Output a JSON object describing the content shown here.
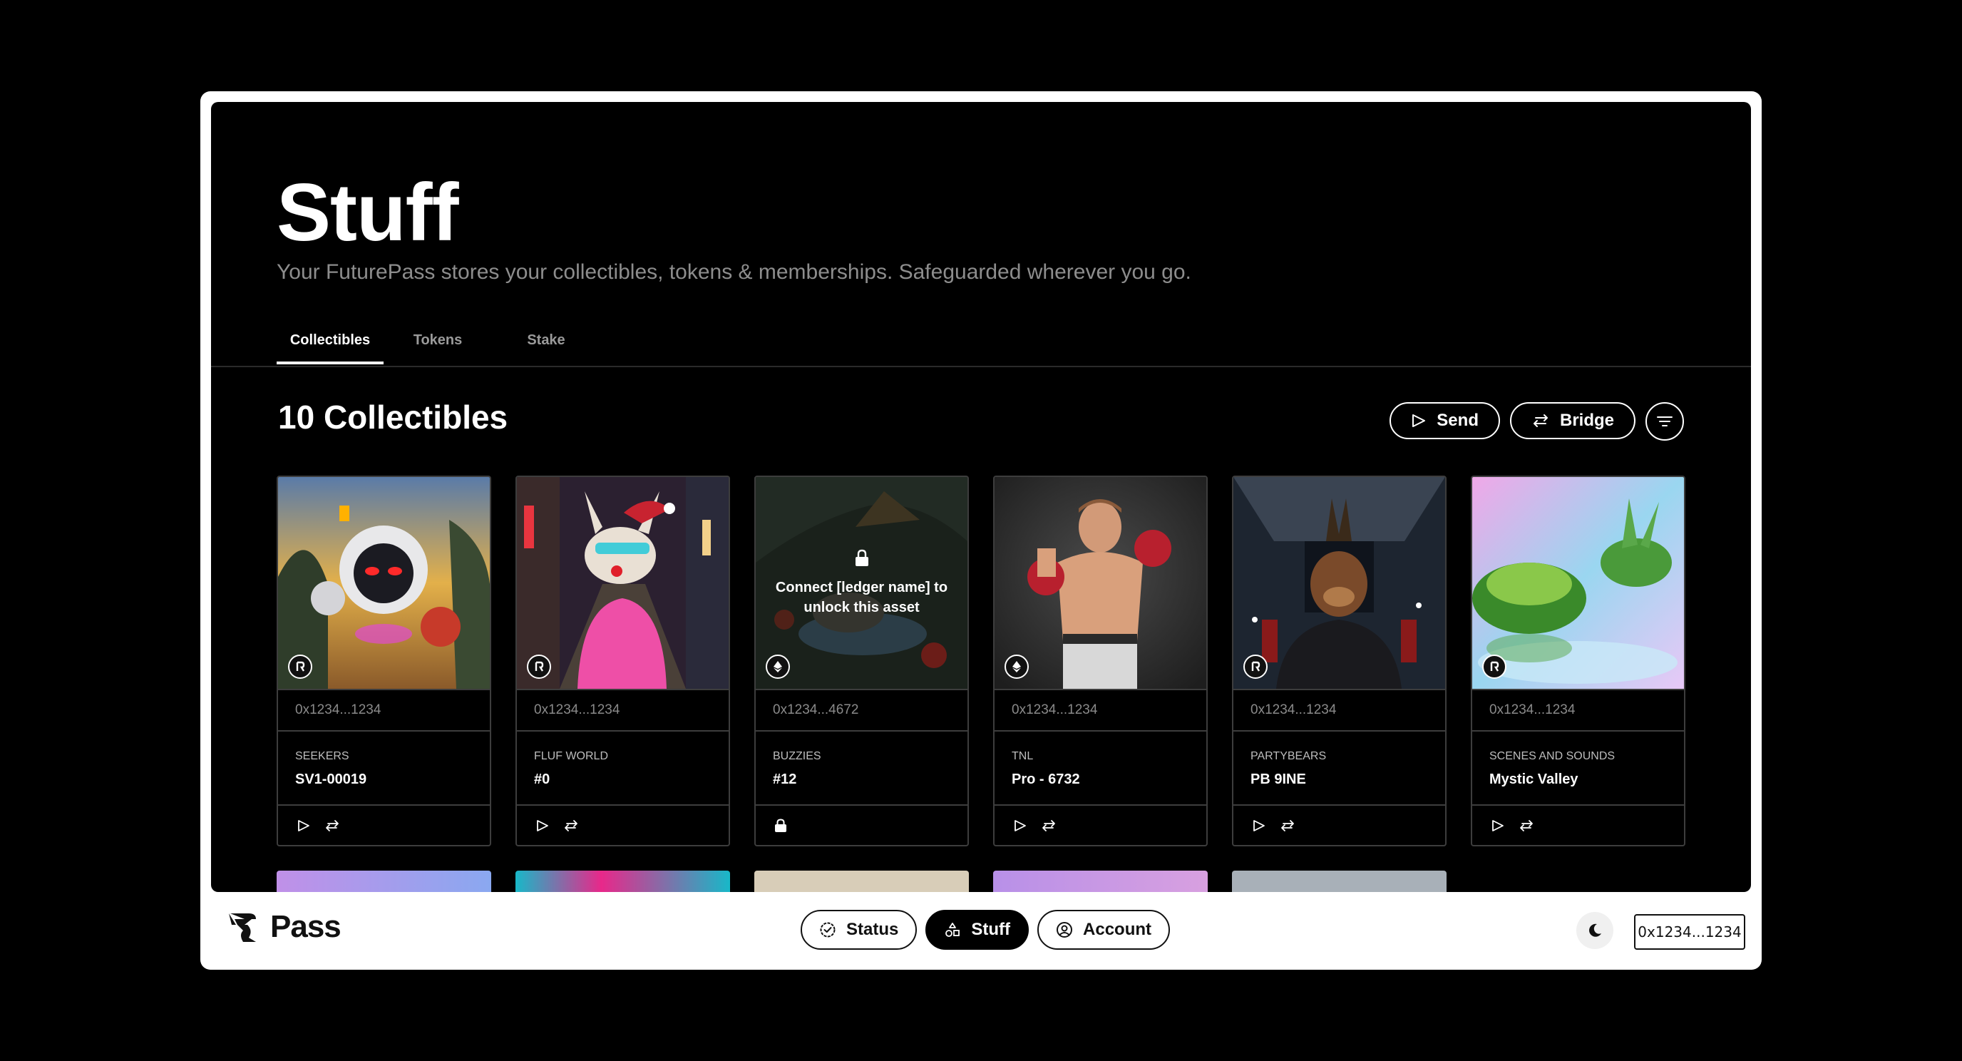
{
  "page": {
    "title": "Stuff",
    "subtitle": "Your FuturePass stores your collectibles, tokens & memberships. Safeguarded wherever you go."
  },
  "tabs": [
    {
      "label": "Collectibles",
      "active": true
    },
    {
      "label": "Tokens",
      "active": false
    },
    {
      "label": "Stake",
      "active": false
    }
  ],
  "collectibles": {
    "heading": "10 Collectibles",
    "send_label": "Send",
    "bridge_label": "Bridge",
    "items": [
      {
        "address": "0x1234...1234",
        "collection": "SEEKERS",
        "name": "SV1-00019",
        "chain_icon": "root-network-icon",
        "locked": false
      },
      {
        "address": "0x1234...1234",
        "collection": "FLUF WORLD",
        "name": "#0",
        "chain_icon": "root-network-icon",
        "locked": false
      },
      {
        "address": "0x1234...4672",
        "collection": "BUZZIES",
        "name": "#12",
        "chain_icon": "ethereum-icon",
        "locked": true,
        "lock_message": "Connect [ledger name] to unlock this asset"
      },
      {
        "address": "0x1234...1234",
        "collection": "TNL",
        "name": "Pro - 6732",
        "chain_icon": "ethereum-icon",
        "locked": false
      },
      {
        "address": "0x1234...1234",
        "collection": "PARTYBEARS",
        "name": "PB 9INE",
        "chain_icon": "root-network-icon",
        "locked": false
      },
      {
        "address": "0x1234...1234",
        "collection": "SCENES AND SOUNDS",
        "name": "Mystic Valley",
        "chain_icon": "root-network-icon",
        "locked": false
      }
    ]
  },
  "bottom_nav": {
    "logo": "Pass",
    "items": [
      {
        "label": "Status",
        "icon": "check-badge-icon",
        "active": false
      },
      {
        "label": "Stuff",
        "icon": "shapes-icon",
        "active": true
      },
      {
        "label": "Account",
        "icon": "user-circle-icon",
        "active": false
      }
    ],
    "wallet_address": "0x1234...1234"
  },
  "colors": {
    "background": "#000000",
    "frame": "#ffffff",
    "card_border": "#3d3d3d",
    "muted_text": "#8d8d8d"
  }
}
